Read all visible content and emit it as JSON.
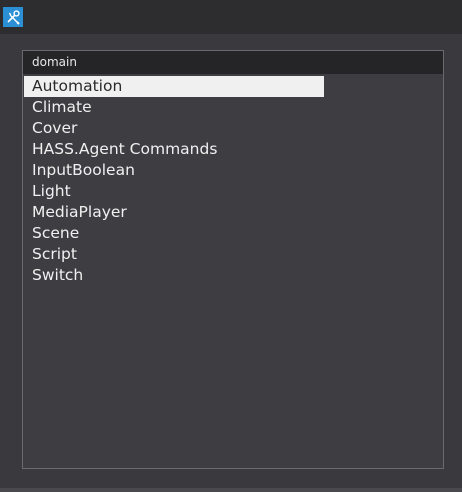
{
  "window": {
    "icon": "tools-icon",
    "accent_color": "#2b8fd6"
  },
  "list": {
    "column_header": "domain",
    "items": [
      {
        "label": "Automation",
        "selected": true
      },
      {
        "label": "Climate",
        "selected": false
      },
      {
        "label": "Cover",
        "selected": false
      },
      {
        "label": "HASS.Agent Commands",
        "selected": false
      },
      {
        "label": "InputBoolean",
        "selected": false
      },
      {
        "label": "Light",
        "selected": false
      },
      {
        "label": "MediaPlayer",
        "selected": false
      },
      {
        "label": "Scene",
        "selected": false
      },
      {
        "label": "Script",
        "selected": false
      },
      {
        "label": "Switch",
        "selected": false
      }
    ]
  }
}
